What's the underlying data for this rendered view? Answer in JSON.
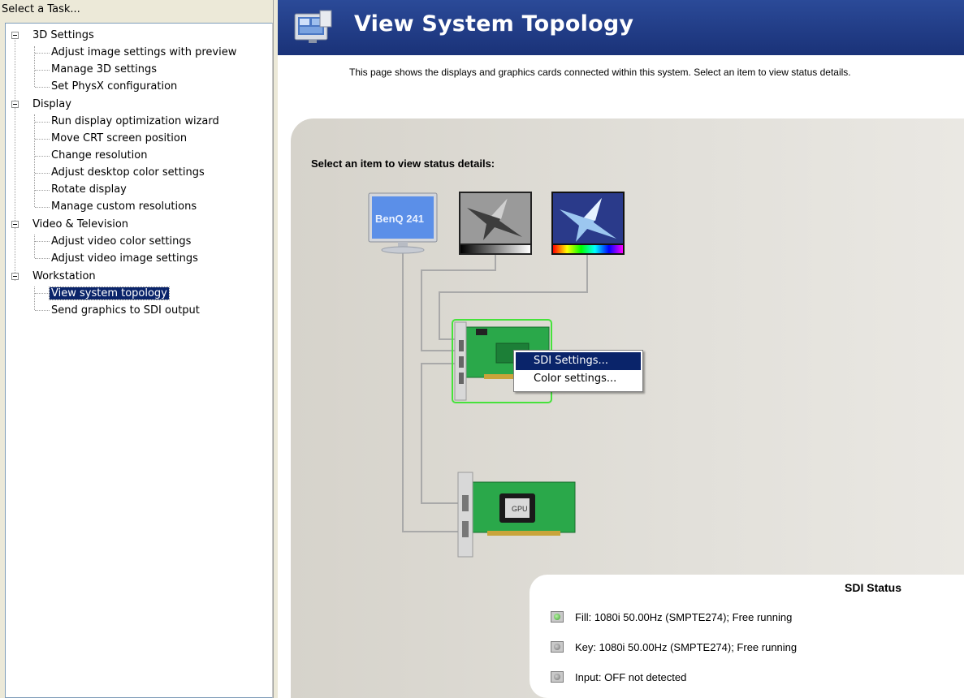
{
  "task_panel": {
    "header": "Select a Task...",
    "tree": [
      {
        "label": "3D Settings",
        "children": [
          "Adjust image settings with preview",
          "Manage 3D settings",
          "Set PhysX configuration"
        ]
      },
      {
        "label": "Display",
        "children": [
          "Run display optimization wizard",
          "Move CRT screen position",
          "Change resolution",
          "Adjust desktop color settings",
          "Rotate display",
          "Manage custom resolutions"
        ]
      },
      {
        "label": "Video & Television",
        "children": [
          "Adjust video color settings",
          "Adjust video image settings"
        ]
      },
      {
        "label": "Workstation",
        "children": [
          "View system topology",
          "Send graphics to SDI output"
        ]
      }
    ],
    "selected": "View system topology"
  },
  "header": {
    "title": "View System Topology",
    "description": "This page shows the displays and graphics cards connected within this system. Select an item to view status details."
  },
  "topology": {
    "select_label": "Select an item to view status details:",
    "monitor_label": "BenQ 241",
    "gpu_chip_label": "GPU"
  },
  "context_menu": {
    "items": [
      "SDI Settings...",
      "Color settings..."
    ],
    "highlighted_index": 0
  },
  "sdi_status": {
    "title": "SDI Status",
    "rows": [
      {
        "led": "green",
        "text": "Fill: 1080i  50.00Hz  (SMPTE274); Free running"
      },
      {
        "led": "grey",
        "text": "Key: 1080i  50.00Hz  (SMPTE274); Free running"
      },
      {
        "led": "grey",
        "text": "Input: OFF   not detected"
      }
    ]
  },
  "colors": {
    "header_blue": "#1f3b88",
    "selection": "#0a246a",
    "card_green": "#1e9a3c",
    "panel_grey": "#dcdad3"
  }
}
